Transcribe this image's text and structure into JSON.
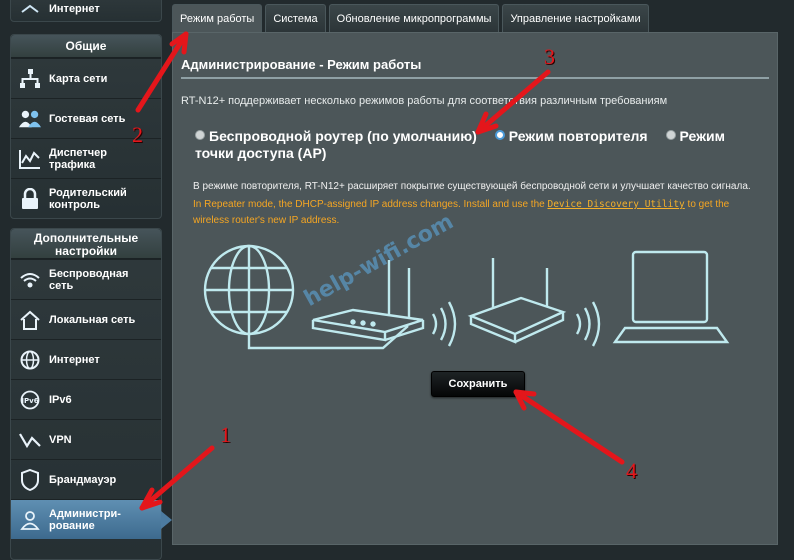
{
  "sidebar": {
    "top_item": "Интернет",
    "general": {
      "title": "Общие",
      "items": [
        {
          "label": "Карта сети"
        },
        {
          "label": "Гостевая сеть"
        },
        {
          "label": "Диспетчер трафика"
        },
        {
          "label": "Родительский контроль"
        }
      ]
    },
    "advanced": {
      "title": "Дополнительные настройки",
      "items": [
        {
          "label": "Беспроводная сеть"
        },
        {
          "label": "Локальная сеть"
        },
        {
          "label": "Интернет"
        },
        {
          "label": "IPv6"
        },
        {
          "label": "VPN"
        },
        {
          "label": "Брандмауэр"
        },
        {
          "label": "Администри-рование",
          "active": true
        }
      ]
    }
  },
  "tabs": [
    {
      "label": "Режим работы",
      "active": true
    },
    {
      "label": "Система"
    },
    {
      "label": "Обновление микропрограммы"
    },
    {
      "label": "Управление настройками"
    }
  ],
  "main": {
    "title": "Администрирование - Режим работы",
    "description": "RT-N12+ поддерживает несколько режимов работы для соответствия различным требованиям",
    "modes": [
      {
        "label": "Беспроводной роутер (по умолчанию)",
        "selected": false
      },
      {
        "label": "Режим повторителя",
        "selected": true
      },
      {
        "label": "Режим точки доступа (AP)",
        "selected": false
      }
    ],
    "note_ru": "В режиме повторителя, RT-N12+ расширяет покрытие существующей беспроводной сети и улучшает качество сигнала.",
    "note_en_prefix": "In Repeater mode, the DHCP-assigned IP address changes. Install and use the",
    "note_en_link": "Device Discovery Utility",
    "note_en_suffix": "to get the wireless router's new IP address.",
    "save_label": "Сохранить"
  },
  "overlay": {
    "watermark": "help-wifi.com",
    "annotations": [
      "1",
      "2",
      "3",
      "4"
    ],
    "arrow_color": "#e4161b"
  }
}
